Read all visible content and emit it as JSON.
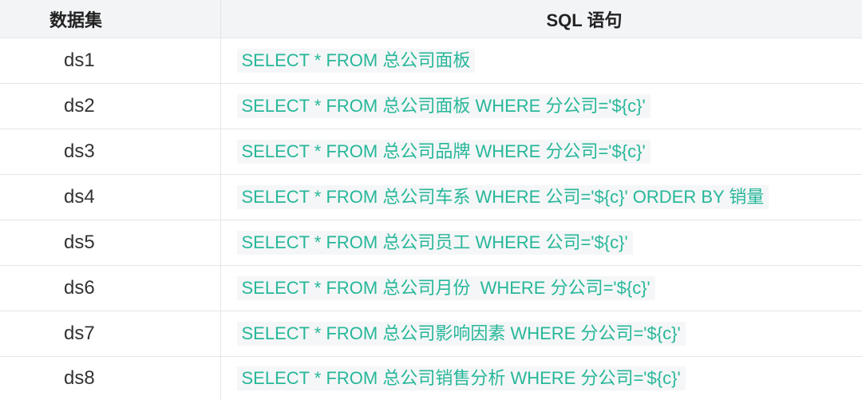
{
  "header": {
    "col1": "数据集",
    "col2": "SQL 语句"
  },
  "rows": [
    {
      "dataset": "ds1",
      "sql": "SELECT * FROM 总公司面板"
    },
    {
      "dataset": "ds2",
      "sql": "SELECT * FROM 总公司面板 WHERE 分公司='${c}'"
    },
    {
      "dataset": "ds3",
      "sql": "SELECT * FROM 总公司品牌 WHERE 分公司='${c}'"
    },
    {
      "dataset": "ds4",
      "sql": "SELECT * FROM 总公司车系 WHERE 公司='${c}' ORDER BY 销量"
    },
    {
      "dataset": "ds5",
      "sql": "SELECT * FROM 总公司员工 WHERE 公司='${c}'"
    },
    {
      "dataset": "ds6",
      "sql": "SELECT * FROM 总公司月份  WHERE 分公司='${c}'"
    },
    {
      "dataset": "ds7",
      "sql": "SELECT * FROM 总公司影响因素 WHERE 分公司='${c}'"
    },
    {
      "dataset": "ds8",
      "sql": "SELECT * FROM 总公司销售分析 WHERE 分公司='${c}'"
    }
  ],
  "colors": {
    "header_bg": "#f3f4f6",
    "sql_text": "#27b79a",
    "sql_bg": "#f5f6f7",
    "border": "#e3e5e8"
  }
}
